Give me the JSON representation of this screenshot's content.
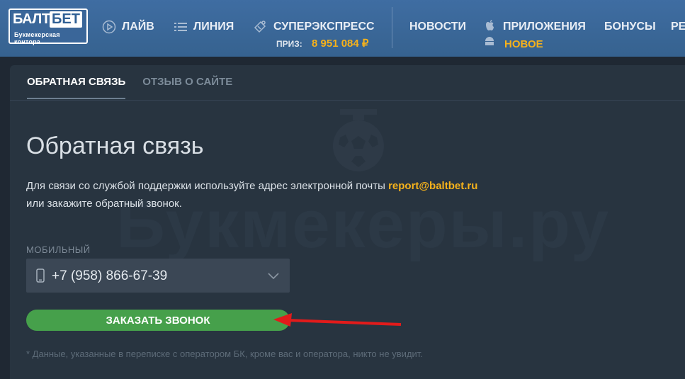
{
  "header": {
    "logo": {
      "part1": "БАЛТ",
      "part2": "БЕТ",
      "tagline": "Букмекерская контора"
    },
    "nav": [
      {
        "label": "ЛАЙВ",
        "icon": "play-circle-icon"
      },
      {
        "label": "ЛИНИЯ",
        "icon": "list-icon"
      },
      {
        "label": "СУПЕРЭКСПРЕСС",
        "icon": "ticket-icon"
      },
      {
        "label": "НОВОСТИ"
      },
      {
        "label": "ПРИЛОЖЕНИЯ",
        "icon": "apple-android-icon"
      },
      {
        "label": "БОНУСЫ"
      },
      {
        "label": "РЕ"
      }
    ],
    "prize_label": "ПРИЗ:",
    "prize_value": "8 951 084 ₽",
    "new_badge": "НОВОЕ"
  },
  "tabs": [
    {
      "label": "ОБРАТНАЯ СВЯЗЬ",
      "active": true
    },
    {
      "label": "ОТЗЫВ О САЙТЕ",
      "active": false
    }
  ],
  "watermark": "Букмекеры.ру",
  "main": {
    "title": "Обратная связь",
    "desc_before": "Для связи со службой поддержки используйте адрес электронной почты ",
    "email": "report@baltbet.ru",
    "desc_after": "или закажите обратный звонок.",
    "phone_label": "МОБИЛЬНЫЙ",
    "phone_value": "+7 (958) 866-67-39",
    "cta_label": "ЗАКАЗАТЬ ЗВОНОК",
    "note": "* Данные, указанные в переписке с оператором БК, кроме вас и оператора, никто не увидит."
  },
  "colors": {
    "header": "#3c6a9e",
    "accent": "#f6b21b",
    "cta": "#46a04b",
    "panel": "#283440",
    "arrow": "#e21b1b"
  }
}
